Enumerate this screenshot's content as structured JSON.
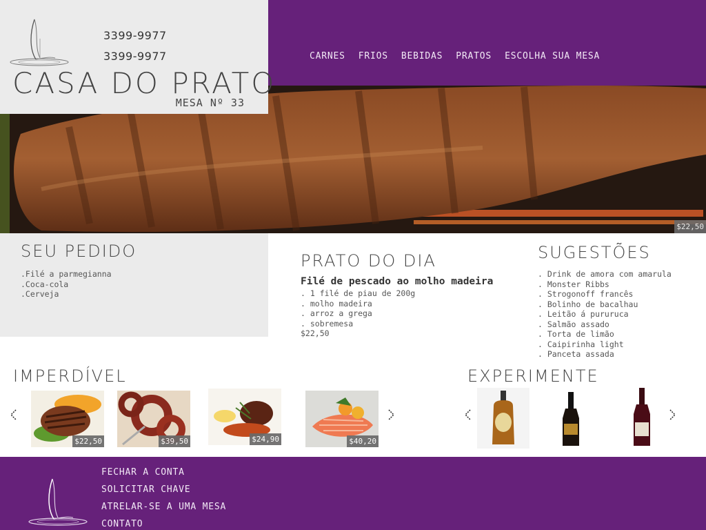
{
  "header": {
    "phones": [
      "3399-9977",
      "3399-9977"
    ],
    "brand": "CASA DO PRATO",
    "table_number": "MESA Nº 33",
    "nav": [
      "CARNES",
      "FRIOS",
      "BEBIDAS",
      "PRATOS",
      "ESCOLHA SUA MESA"
    ],
    "logo_icon": "flame-plate-icon"
  },
  "hero": {
    "price": "$22,50"
  },
  "order": {
    "title": "SEU PEDIDO",
    "items": [
      ".Filé a parmegianna",
      ".Coca-cola",
      ".Cerveja"
    ]
  },
  "daily": {
    "title": "PRATO DO DIA",
    "dish": "Filé de pescado ao molho madeira",
    "items": [
      ". 1 filé de piau de 200g",
      ". molho madeira",
      ". arroz a grega",
      ". sobremesa"
    ],
    "price": "$22,50"
  },
  "suggestions": {
    "title": "SUGESTÕES",
    "items": [
      ". Drink de amora com amarula",
      ". Monster Ribbs",
      ". Strogonoff francês",
      ". Bolinho de bacalhau",
      ". Leitão á pururuca",
      ". Salmão assado",
      ". Torta de limão",
      ". Caipirinha light",
      ". Panceta assada"
    ]
  },
  "must_try": {
    "title": "IMPERDÍVEL",
    "prices": [
      "$22,50",
      "$39,50",
      "$24,90",
      "$40,20"
    ]
  },
  "experiment": {
    "title": "EXPERIMENTE"
  },
  "footer": {
    "links": [
      "FECHAR A CONTA",
      "SOLICITAR CHAVE",
      "ATRELAR-SE A UMA MESA",
      "CONTATO"
    ]
  },
  "colors": {
    "brand_purple": "#66217a",
    "panel_gray": "#ebebeb",
    "price_tag": "#6a6a6a"
  }
}
